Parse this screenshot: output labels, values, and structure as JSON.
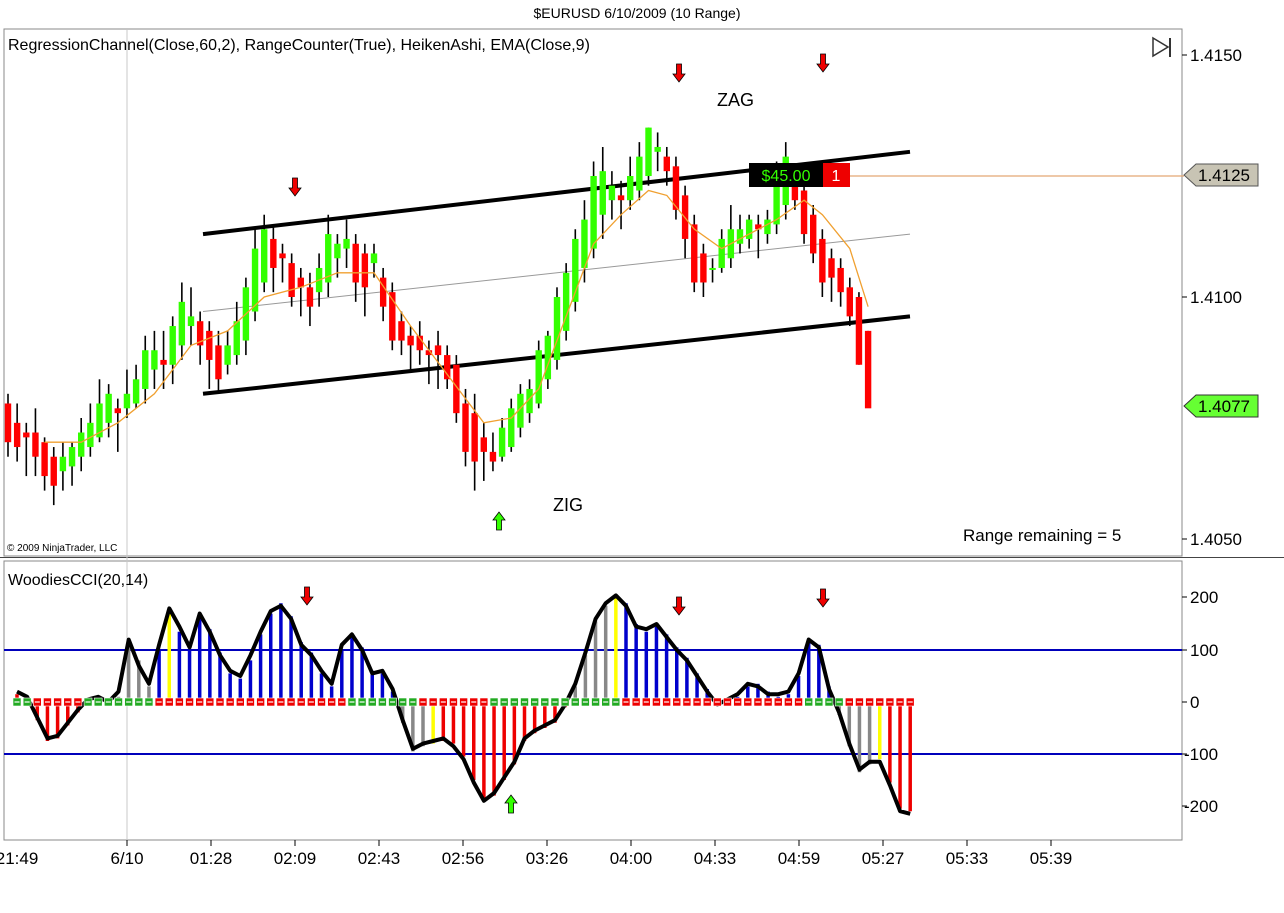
{
  "window_title": "$EURUSD  6/10/2009 (10 Range)",
  "copyright": "© 2009 NinjaTrader, LLC",
  "price_panel": {
    "indicator_label": "RegressionChannel(Close,60,2), RangeCounter(True), HeikenAshi, EMA(Close,9)",
    "y_ticks": [
      "1.4150",
      "1.4100",
      "1.4050"
    ],
    "ylim": [
      1.405,
      1.415
    ],
    "annotations": {
      "zag": "ZAG",
      "zig": "ZIG"
    },
    "range_remaining": "Range remaining = 5",
    "position_pnl": "$45.00",
    "position_qty": "1",
    "entry_price_label": "1.4125",
    "last_price_label": "1.4077"
  },
  "cci_panel": {
    "indicator_label": "WoodiesCCI(20,14)",
    "y_ticks": [
      "200",
      "100",
      "0",
      "-100",
      "-200"
    ],
    "ylim": [
      -250,
      250
    ]
  },
  "x_ticks": [
    "21:49",
    "6/10",
    "01:28",
    "02:09",
    "02:43",
    "02:56",
    "03:26",
    "04:00",
    "04:33",
    "04:59",
    "05:27",
    "05:33",
    "05:39"
  ],
  "colors": {
    "up": "#33ff00",
    "down": "#ff0000",
    "cci_line": "#000000",
    "cci_blue": "#0000cc",
    "cci_red": "#ee0000",
    "cci_gray": "#888888",
    "cci_yellow": "#ffff00",
    "band": "#0000bb",
    "ema": "#f0a030",
    "entry_line": "#e3a775",
    "last_price_bg": "#66ff33"
  },
  "chart_data": [
    {
      "type": "candlestick",
      "title": "$EURUSD  6/10/2009 (10 Range)",
      "series_note": "HeikenAshi bars, oldest to newest",
      "bars": [
        {
          "o": 1.4078,
          "h": 1.408,
          "l": 1.4067,
          "c": 1.407
        },
        {
          "o": 1.4074,
          "h": 1.4078,
          "l": 1.4066,
          "c": 1.4069
        },
        {
          "o": 1.4072,
          "h": 1.4074,
          "l": 1.4063,
          "c": 1.4071
        },
        {
          "o": 1.4072,
          "h": 1.4077,
          "l": 1.4063,
          "c": 1.4067
        },
        {
          "o": 1.407,
          "h": 1.4071,
          "l": 1.406,
          "c": 1.4063
        },
        {
          "o": 1.4067,
          "h": 1.4069,
          "l": 1.4057,
          "c": 1.4061
        },
        {
          "o": 1.4064,
          "h": 1.407,
          "l": 1.406,
          "c": 1.4067
        },
        {
          "o": 1.4065,
          "h": 1.407,
          "l": 1.4061,
          "c": 1.4069
        },
        {
          "o": 1.4067,
          "h": 1.4075,
          "l": 1.4064,
          "c": 1.4072
        },
        {
          "o": 1.4069,
          "h": 1.4078,
          "l": 1.4067,
          "c": 1.4074
        },
        {
          "o": 1.4071,
          "h": 1.4083,
          "l": 1.407,
          "c": 1.4078
        },
        {
          "o": 1.4074,
          "h": 1.4082,
          "l": 1.4071,
          "c": 1.408
        },
        {
          "o": 1.4077,
          "h": 1.4079,
          "l": 1.4068,
          "c": 1.4076
        },
        {
          "o": 1.4077,
          "h": 1.4085,
          "l": 1.4075,
          "c": 1.408
        },
        {
          "o": 1.4078,
          "h": 1.4086,
          "l": 1.4077,
          "c": 1.4083
        },
        {
          "o": 1.4081,
          "h": 1.4092,
          "l": 1.4078,
          "c": 1.4089
        },
        {
          "o": 1.4085,
          "h": 1.4093,
          "l": 1.4081,
          "c": 1.4089
        },
        {
          "o": 1.4087,
          "h": 1.4093,
          "l": 1.4081,
          "c": 1.4086
        },
        {
          "o": 1.4086,
          "h": 1.4096,
          "l": 1.4082,
          "c": 1.4094
        },
        {
          "o": 1.409,
          "h": 1.4103,
          "l": 1.4087,
          "c": 1.4099
        },
        {
          "o": 1.4094,
          "h": 1.4102,
          "l": 1.409,
          "c": 1.4096
        },
        {
          "o": 1.4095,
          "h": 1.4097,
          "l": 1.4086,
          "c": 1.409
        },
        {
          "o": 1.4093,
          "h": 1.4095,
          "l": 1.4081,
          "c": 1.4087
        },
        {
          "o": 1.409,
          "h": 1.4093,
          "l": 1.408,
          "c": 1.4083
        },
        {
          "o": 1.4086,
          "h": 1.4093,
          "l": 1.4084,
          "c": 1.409
        },
        {
          "o": 1.4088,
          "h": 1.4099,
          "l": 1.4086,
          "c": 1.4095
        },
        {
          "o": 1.4091,
          "h": 1.4104,
          "l": 1.4088,
          "c": 1.4102
        },
        {
          "o": 1.4097,
          "h": 1.4114,
          "l": 1.4095,
          "c": 1.411
        },
        {
          "o": 1.4103,
          "h": 1.4117,
          "l": 1.4101,
          "c": 1.4114
        },
        {
          "o": 1.4112,
          "h": 1.4115,
          "l": 1.4101,
          "c": 1.4106
        },
        {
          "o": 1.4109,
          "h": 1.4111,
          "l": 1.4103,
          "c": 1.4108
        },
        {
          "o": 1.4107,
          "h": 1.4109,
          "l": 1.4098,
          "c": 1.41
        },
        {
          "o": 1.4104,
          "h": 1.4106,
          "l": 1.4096,
          "c": 1.4102
        },
        {
          "o": 1.4102,
          "h": 1.4105,
          "l": 1.4094,
          "c": 1.4098
        },
        {
          "o": 1.4101,
          "h": 1.4109,
          "l": 1.4098,
          "c": 1.4106
        },
        {
          "o": 1.4103,
          "h": 1.4117,
          "l": 1.41,
          "c": 1.4113
        },
        {
          "o": 1.4108,
          "h": 1.4113,
          "l": 1.4104,
          "c": 1.4111
        },
        {
          "o": 1.411,
          "h": 1.4116,
          "l": 1.4106,
          "c": 1.4112
        },
        {
          "o": 1.4111,
          "h": 1.4113,
          "l": 1.4099,
          "c": 1.4103
        },
        {
          "o": 1.4109,
          "h": 1.4111,
          "l": 1.4096,
          "c": 1.4102
        },
        {
          "o": 1.4107,
          "h": 1.4111,
          "l": 1.4104,
          "c": 1.4109
        },
        {
          "o": 1.4104,
          "h": 1.4106,
          "l": 1.4095,
          "c": 1.4098
        },
        {
          "o": 1.4101,
          "h": 1.4103,
          "l": 1.4089,
          "c": 1.4091
        },
        {
          "o": 1.4095,
          "h": 1.4097,
          "l": 1.4088,
          "c": 1.4091
        },
        {
          "o": 1.4092,
          "h": 1.4094,
          "l": 1.4085,
          "c": 1.409
        },
        {
          "o": 1.4092,
          "h": 1.4095,
          "l": 1.4086,
          "c": 1.4089
        },
        {
          "o": 1.4089,
          "h": 1.4091,
          "l": 1.4082,
          "c": 1.4088
        },
        {
          "o": 1.409,
          "h": 1.4093,
          "l": 1.4081,
          "c": 1.4088
        },
        {
          "o": 1.4088,
          "h": 1.409,
          "l": 1.4081,
          "c": 1.4083
        },
        {
          "o": 1.4086,
          "h": 1.4088,
          "l": 1.4074,
          "c": 1.4076
        },
        {
          "o": 1.4078,
          "h": 1.4081,
          "l": 1.4065,
          "c": 1.4068
        },
        {
          "o": 1.4076,
          "h": 1.408,
          "l": 1.406,
          "c": 1.4066
        },
        {
          "o": 1.4071,
          "h": 1.4074,
          "l": 1.4062,
          "c": 1.4068
        },
        {
          "o": 1.4068,
          "h": 1.4072,
          "l": 1.4064,
          "c": 1.4066
        },
        {
          "o": 1.4067,
          "h": 1.4075,
          "l": 1.4066,
          "c": 1.4073
        },
        {
          "o": 1.4069,
          "h": 1.4079,
          "l": 1.4068,
          "c": 1.4077
        },
        {
          "o": 1.4073,
          "h": 1.4082,
          "l": 1.4071,
          "c": 1.408
        },
        {
          "o": 1.4076,
          "h": 1.4083,
          "l": 1.4074,
          "c": 1.4081
        },
        {
          "o": 1.4078,
          "h": 1.4091,
          "l": 1.4077,
          "c": 1.4089
        },
        {
          "o": 1.4083,
          "h": 1.4093,
          "l": 1.4081,
          "c": 1.4092
        },
        {
          "o": 1.4087,
          "h": 1.4102,
          "l": 1.4085,
          "c": 1.41
        },
        {
          "o": 1.4093,
          "h": 1.4107,
          "l": 1.4091,
          "c": 1.4105
        },
        {
          "o": 1.4099,
          "h": 1.4114,
          "l": 1.4097,
          "c": 1.4112
        },
        {
          "o": 1.4106,
          "h": 1.412,
          "l": 1.4103,
          "c": 1.4116
        },
        {
          "o": 1.411,
          "h": 1.4128,
          "l": 1.4108,
          "c": 1.4125
        },
        {
          "o": 1.4117,
          "h": 1.4131,
          "l": 1.4112,
          "c": 1.4126
        },
        {
          "o": 1.412,
          "h": 1.4126,
          "l": 1.4116,
          "c": 1.4123
        },
        {
          "o": 1.4121,
          "h": 1.4124,
          "l": 1.4114,
          "c": 1.412
        },
        {
          "o": 1.412,
          "h": 1.4129,
          "l": 1.4118,
          "c": 1.4125
        },
        {
          "o": 1.4122,
          "h": 1.4132,
          "l": 1.412,
          "c": 1.4129
        },
        {
          "o": 1.4125,
          "h": 1.4135,
          "l": 1.4123,
          "c": 1.4135
        },
        {
          "o": 1.413,
          "h": 1.4134,
          "l": 1.4126,
          "c": 1.4131
        },
        {
          "o": 1.4129,
          "h": 1.4131,
          "l": 1.4123,
          "c": 1.4126
        },
        {
          "o": 1.4127,
          "h": 1.4129,
          "l": 1.4116,
          "c": 1.4118
        },
        {
          "o": 1.4121,
          "h": 1.4123,
          "l": 1.4108,
          "c": 1.4112
        },
        {
          "o": 1.4115,
          "h": 1.4117,
          "l": 1.4101,
          "c": 1.4103
        },
        {
          "o": 1.4109,
          "h": 1.4111,
          "l": 1.41,
          "c": 1.4103
        },
        {
          "o": 1.4106,
          "h": 1.4108,
          "l": 1.4103,
          "c": 1.4106
        },
        {
          "o": 1.4106,
          "h": 1.4114,
          "l": 1.4105,
          "c": 1.4112
        },
        {
          "o": 1.4108,
          "h": 1.4119,
          "l": 1.4106,
          "c": 1.4114
        },
        {
          "o": 1.4111,
          "h": 1.4117,
          "l": 1.4109,
          "c": 1.4114
        },
        {
          "o": 1.4112,
          "h": 1.4117,
          "l": 1.411,
          "c": 1.4116
        },
        {
          "o": 1.4115,
          "h": 1.4117,
          "l": 1.4108,
          "c": 1.4114
        },
        {
          "o": 1.4113,
          "h": 1.4118,
          "l": 1.4111,
          "c": 1.4116
        },
        {
          "o": 1.4115,
          "h": 1.4128,
          "l": 1.4113,
          "c": 1.4124
        },
        {
          "o": 1.4119,
          "h": 1.4132,
          "l": 1.4116,
          "c": 1.4129
        },
        {
          "o": 1.4124,
          "h": 1.4127,
          "l": 1.4118,
          "c": 1.412
        },
        {
          "o": 1.4122,
          "h": 1.4124,
          "l": 1.4111,
          "c": 1.4113
        },
        {
          "o": 1.4117,
          "h": 1.4119,
          "l": 1.4107,
          "c": 1.4109
        },
        {
          "o": 1.4112,
          "h": 1.4114,
          "l": 1.41,
          "c": 1.4103
        },
        {
          "o": 1.4108,
          "h": 1.411,
          "l": 1.4099,
          "c": 1.4104
        },
        {
          "o": 1.4106,
          "h": 1.4108,
          "l": 1.4098,
          "c": 1.4101
        },
        {
          "o": 1.4102,
          "h": 1.4104,
          "l": 1.4094,
          "c": 1.4096
        },
        {
          "o": 1.41,
          "h": 1.4101,
          "l": 1.4086,
          "c": 1.4086
        },
        {
          "o": 1.4093,
          "h": 1.4093,
          "l": 1.4079,
          "c": 1.4077
        }
      ],
      "ema_note": "EMA(Close,9)",
      "ema": [
        {
          "i": 4,
          "v": 1.407
        },
        {
          "i": 8,
          "v": 1.407
        },
        {
          "i": 12,
          "v": 1.4074
        },
        {
          "i": 16,
          "v": 1.408
        },
        {
          "i": 20,
          "v": 1.409
        },
        {
          "i": 24,
          "v": 1.4093
        },
        {
          "i": 28,
          "v": 1.41
        },
        {
          "i": 32,
          "v": 1.4102
        },
        {
          "i": 36,
          "v": 1.4105
        },
        {
          "i": 40,
          "v": 1.4105
        },
        {
          "i": 44,
          "v": 1.4094
        },
        {
          "i": 48,
          "v": 1.4084
        },
        {
          "i": 52,
          "v": 1.4074
        },
        {
          "i": 55,
          "v": 1.4075
        },
        {
          "i": 58,
          "v": 1.4081
        },
        {
          "i": 61,
          "v": 1.4096
        },
        {
          "i": 64,
          "v": 1.4111
        },
        {
          "i": 67,
          "v": 1.4117
        },
        {
          "i": 70,
          "v": 1.4122
        },
        {
          "i": 72,
          "v": 1.4121
        },
        {
          "i": 75,
          "v": 1.4114
        },
        {
          "i": 78,
          "v": 1.411
        },
        {
          "i": 81,
          "v": 1.4113
        },
        {
          "i": 84,
          "v": 1.4116
        },
        {
          "i": 87,
          "v": 1.412
        },
        {
          "i": 89,
          "v": 1.4117
        },
        {
          "i": 92,
          "v": 1.411
        },
        {
          "i": 94,
          "v": 1.4098
        }
      ],
      "regression_channel": {
        "start_index": 26,
        "end_index": 94,
        "mid_start": 1.4097,
        "mid_end": 1.4113,
        "upper_start": 1.4113,
        "upper_end": 1.413,
        "lower_start": 1.408,
        "lower_end": 1.4096
      },
      "entry_price": 1.4125,
      "last_price": 1.4077,
      "markers": [
        {
          "i": 37,
          "dir": "down",
          "at": 1.4118
        },
        {
          "i": 62,
          "dir": "up",
          "at": 1.4055
        },
        {
          "i": 84,
          "dir": "down",
          "at": 1.414
        },
        {
          "i": 102,
          "dir": "down",
          "at": 1.4142
        }
      ]
    },
    {
      "type": "bar",
      "title": "WoodiesCCI(20,14)",
      "cci": [
        15,
        5,
        -35,
        -75,
        -70,
        -45,
        -20,
        0,
        5,
        -5,
        10,
        110,
        80,
        30,
        100,
        175,
        135,
        100,
        165,
        140,
        95,
        55,
        45,
        80,
        130,
        170,
        190,
        165,
        115,
        95,
        55,
        30,
        100,
        125,
        105,
        60,
        55,
        20,
        -40,
        -95,
        -85,
        -80,
        -75,
        -80,
        -105,
        -150,
        -185,
        -180,
        -150,
        -120,
        -75,
        -60,
        -50,
        -40,
        -10,
        30,
        90,
        155,
        185,
        200,
        190,
        150,
        135,
        145,
        130,
        105,
        85,
        55,
        25,
        0,
        0,
        10,
        30,
        35,
        20,
        10,
        15,
        50,
        115,
        110,
        30,
        -25,
        -85,
        -135,
        -120,
        -110,
        -155,
        -205,
        -210
      ],
      "turbo": [
        20,
        10,
        -30,
        -70,
        -65,
        -40,
        -15,
        5,
        10,
        0,
        20,
        120,
        70,
        35,
        110,
        180,
        145,
        105,
        170,
        135,
        90,
        60,
        50,
        90,
        135,
        175,
        185,
        160,
        110,
        90,
        60,
        35,
        110,
        130,
        100,
        55,
        60,
        25,
        -35,
        -90,
        -80,
        -75,
        -70,
        -85,
        -110,
        -155,
        -190,
        -175,
        -145,
        -115,
        -70,
        -55,
        -45,
        -35,
        -5,
        35,
        95,
        160,
        190,
        205,
        185,
        145,
        140,
        150,
        125,
        100,
        80,
        50,
        20,
        -5,
        5,
        15,
        35,
        30,
        15,
        15,
        20,
        55,
        120,
        105,
        25,
        -20,
        -80,
        -130,
        -115,
        -115,
        -160,
        -210,
        -215
      ],
      "bar_colors": [
        "r",
        "r",
        "r",
        "r",
        "r",
        "r",
        "r",
        "g",
        "g",
        "g",
        "g",
        "g",
        "g",
        "g",
        "b",
        "y",
        "b",
        "b",
        "b",
        "b",
        "b",
        "b",
        "b",
        "b",
        "b",
        "b",
        "b",
        "b",
        "b",
        "b",
        "b",
        "b",
        "b",
        "b",
        "b",
        "b",
        "b",
        "b",
        "g",
        "g",
        "g",
        "y",
        "r",
        "r",
        "r",
        "r",
        "r",
        "r",
        "r",
        "r",
        "r",
        "r",
        "r",
        "r",
        "r",
        "g",
        "g",
        "g",
        "g",
        "y",
        "b",
        "b",
        "b",
        "b",
        "b",
        "b",
        "b",
        "b",
        "b",
        "b",
        "b",
        "b",
        "b",
        "b",
        "b",
        "b",
        "b",
        "b",
        "b",
        "b",
        "b",
        "g",
        "g",
        "g",
        "g",
        "y",
        "r",
        "r",
        "r"
      ],
      "sideway_markers": [
        "g",
        "g",
        "r",
        "r",
        "r",
        "r",
        "r",
        "g",
        "g",
        "g",
        "g",
        "g",
        "g",
        "g",
        "r",
        "r",
        "r",
        "r",
        "r",
        "r",
        "r",
        "r",
        "r",
        "r",
        "r",
        "r",
        "r",
        "r",
        "r",
        "r",
        "r",
        "r",
        "r",
        "g",
        "g",
        "g",
        "g",
        "g",
        "g",
        "g",
        "r",
        "r",
        "r",
        "r",
        "r",
        "r",
        "r",
        "g",
        "g",
        "g",
        "g",
        "g",
        "g",
        "g",
        "g",
        "g",
        "g",
        "g",
        "g",
        "g",
        "r",
        "r",
        "r",
        "r",
        "r",
        "r",
        "r",
        "r",
        "r",
        "r",
        "r",
        "r",
        "r",
        "r",
        "r",
        "r",
        "r",
        "r",
        "g",
        "g",
        "g",
        "g",
        "r",
        "r",
        "r",
        "r",
        "r",
        "r",
        "r"
      ],
      "bands": [
        100,
        -100
      ],
      "ylim": [
        -250,
        250
      ]
    }
  ]
}
